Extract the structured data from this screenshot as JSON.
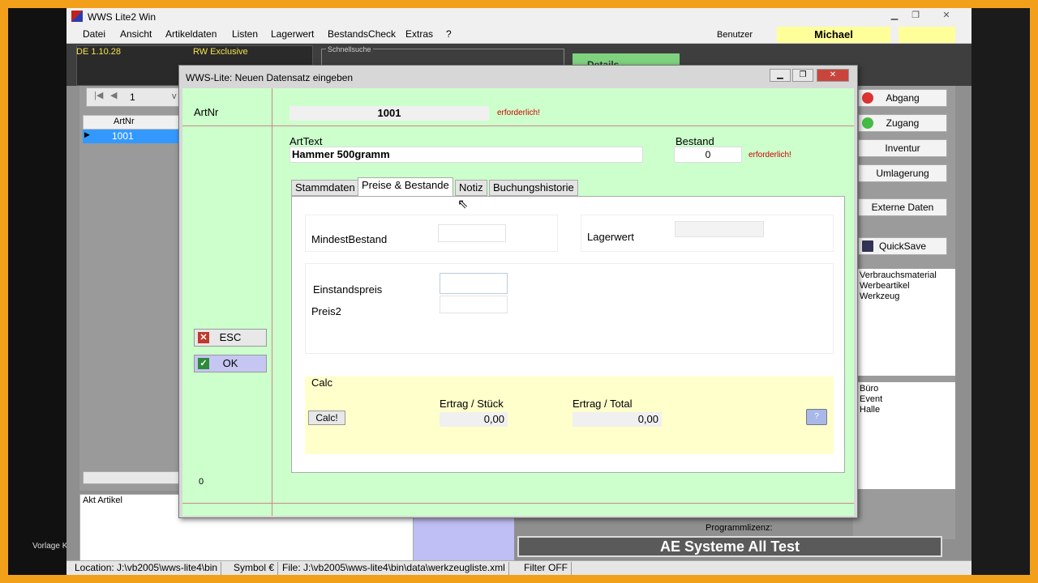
{
  "window": {
    "title": "WWS Lite2 Win"
  },
  "menu": [
    "Datei",
    "Ansicht",
    "Artikeldaten",
    "Listen",
    "Lagerwert",
    "BestandsCheck",
    "Extras",
    "?"
  ],
  "user": {
    "label": "Benutzer",
    "name": "Michael"
  },
  "header": {
    "version": "DE 1.10.28",
    "edition": "RW Exclusive",
    "quicksearch_label": "Schnellsuche",
    "details_label": "Details"
  },
  "navigator": {
    "record": "1"
  },
  "grid": {
    "column": "ArtNr",
    "rows": [
      "1001"
    ]
  },
  "akt_artikel_label": "Akt Artikel",
  "right_buttons": {
    "abgang": "Abgang",
    "zugang": "Zugang",
    "inventur": "Inventur",
    "umlagerung": "Umlagerung",
    "externe": "Externe Daten",
    "quicksave": "QuickSave"
  },
  "categories": [
    "Verbrauchsmaterial",
    "Werbeartikel",
    "Werkzeug"
  ],
  "locations": [
    "Büro",
    "Event",
    "Halle"
  ],
  "license": {
    "label": "Programmlizenz:",
    "value": "AE Systeme All Test"
  },
  "status_bar": {
    "location": "Location:  J:\\vb2005\\wws-lite4\\bin",
    "symbol": "Symbol €",
    "file": "File:  J:\\vb2005\\wws-lite4\\bin\\data\\werkzeugliste.xml",
    "filter": "Filter OFF"
  },
  "desktop": {
    "vorlage": "Vorlage Kata..."
  },
  "dialog": {
    "title": "WWS-Lite: Neuen Datensatz eingeben",
    "artnr_label": "ArtNr",
    "artnr_value": "1001",
    "required": "erforderlich!",
    "arttext_label": "ArtText",
    "arttext_value": "Hammer 500gramm",
    "bestand_label": "Bestand",
    "bestand_value": "0",
    "tabs": [
      "Stammdaten",
      "Preise & Bestande",
      "Notiz",
      "Buchungshistorie"
    ],
    "mindestbestand_label": "MindestBestand",
    "lagerwert_label": "Lagerwert",
    "einstandspreis_label": "Einstandspreis",
    "preis2_label": "Preis2",
    "calc": {
      "label": "Calc",
      "button": "Calc!",
      "ertrag_stueck_label": "Ertrag / Stück",
      "ertrag_stueck_value": "0,00",
      "ertrag_total_label": "Ertrag / Total",
      "ertrag_total_value": "0,00"
    },
    "esc": "ESC",
    "ok": "OK",
    "counter": "0"
  }
}
